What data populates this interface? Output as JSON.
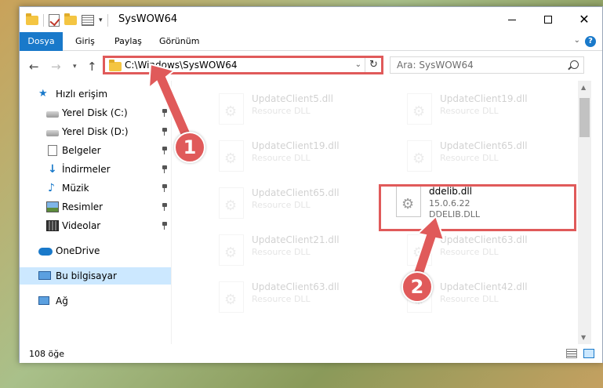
{
  "window": {
    "title": "SysWOW64",
    "minimize_label": "",
    "maximize_label": "",
    "close_label": "✕"
  },
  "ribbon": {
    "tabs": [
      {
        "label": "Dosya",
        "active": true
      },
      {
        "label": "Giriş"
      },
      {
        "label": "Paylaş"
      },
      {
        "label": "Görünüm"
      }
    ],
    "help": "?"
  },
  "address": {
    "path": "C:\\Windows\\SysWOW64",
    "refresh_icon": "refresh-icon"
  },
  "search": {
    "placeholder": "Ara: SysWOW64"
  },
  "sidebar": {
    "items": [
      {
        "label": "Hızlı erişim",
        "icon": "star-icon"
      },
      {
        "label": "Yerel Disk (C:)",
        "icon": "drive-icon",
        "pinned": true
      },
      {
        "label": "Yerel Disk (D:)",
        "icon": "drive-icon",
        "pinned": true
      },
      {
        "label": "Belgeler",
        "icon": "document-icon",
        "pinned": true
      },
      {
        "label": "İndirmeler",
        "icon": "download-icon",
        "pinned": true
      },
      {
        "label": "Müzik",
        "icon": "music-icon",
        "pinned": true
      },
      {
        "label": "Resimler",
        "icon": "picture-icon",
        "pinned": true
      },
      {
        "label": "Videolar",
        "icon": "video-icon",
        "pinned": true
      },
      {
        "label": "OneDrive",
        "icon": "cloud-icon"
      },
      {
        "label": "Bu bilgisayar",
        "icon": "computer-icon",
        "selected": true
      },
      {
        "label": "Ağ",
        "icon": "network-icon"
      }
    ]
  },
  "files": [
    {
      "name": "UpdateClient5.dll",
      "desc": "Resource DLL",
      "faded": true
    },
    {
      "name": "UpdateClient19.dll",
      "desc": "Resource DLL",
      "faded": true
    },
    {
      "name": "UpdateClient19.dll",
      "desc": "Resource DLL",
      "faded": true
    },
    {
      "name": "UpdateClient65.dll",
      "desc": "Resource DLL",
      "faded": true
    },
    {
      "name": "UpdateClient65.dll",
      "desc": "Resource DLL",
      "faded": true
    },
    {
      "name": "ddelib.dll",
      "version": "15.0.6.22",
      "desc": "DDELIB.DLL",
      "faded": false
    },
    {
      "name": "UpdateClient21.dll",
      "desc": "Resource DLL",
      "faded": true
    },
    {
      "name": "UpdateClient63.dll",
      "desc": "Resource DLL",
      "faded": true
    },
    {
      "name": "UpdateClient63.dll",
      "desc": "Resource DLL",
      "faded": true
    },
    {
      "name": "UpdateClient42.dll",
      "desc": "Resource DLL",
      "faded": true
    }
  ],
  "status": {
    "item_count": "108 öğe"
  },
  "annotations": {
    "step1": "1",
    "step2": "2",
    "color": "#e05a5a"
  }
}
